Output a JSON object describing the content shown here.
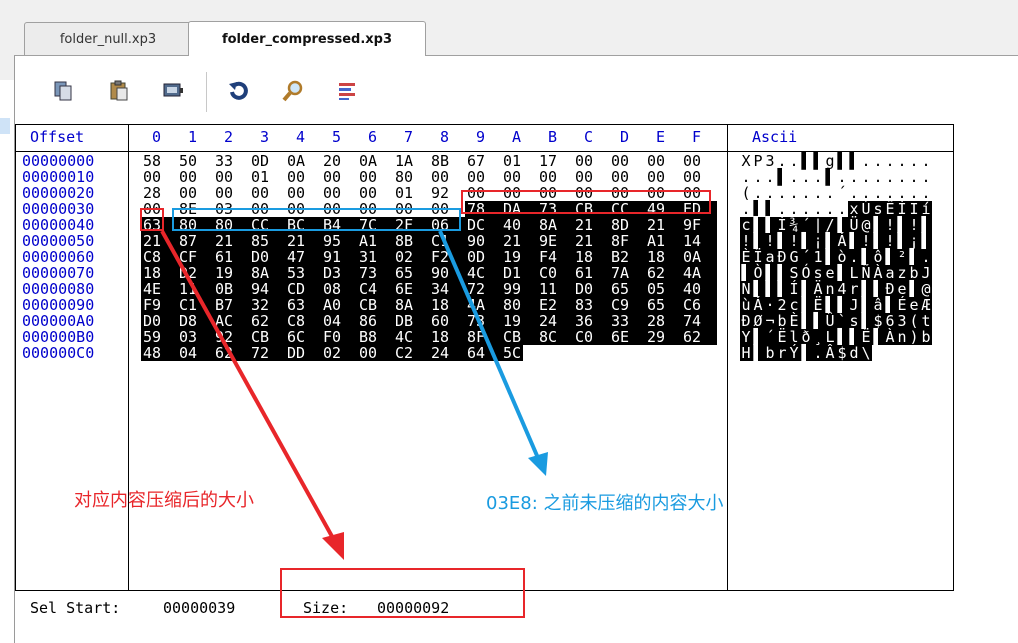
{
  "tabs": [
    {
      "label": "folder_null.xp3",
      "active": false
    },
    {
      "label": "folder_compressed.xp3",
      "active": true
    }
  ],
  "toolbar": {
    "icons": [
      "copy-icon",
      "paste-icon",
      "insert-icon",
      "refresh-icon",
      "find-icon",
      "info-icon"
    ]
  },
  "header": {
    "offset_label": "Offset",
    "columns": [
      "0",
      "1",
      "2",
      "3",
      "4",
      "5",
      "6",
      "7",
      "8",
      "9",
      "A",
      "B",
      "C",
      "D",
      "E",
      "F"
    ],
    "ascii_label": "Ascii"
  },
  "offsets": [
    "00000000",
    "00000010",
    "00000020",
    "00000030",
    "00000040",
    "00000050",
    "00000060",
    "00000070",
    "00000080",
    "00000090",
    "000000A0",
    "000000B0",
    "000000C0"
  ],
  "rows": [
    [
      "58",
      "50",
      "33",
      "0D",
      "0A",
      "20",
      "0A",
      "1A",
      "8B",
      "67",
      "01",
      "17",
      "00",
      "00",
      "00",
      "00"
    ],
    [
      "00",
      "00",
      "00",
      "01",
      "00",
      "00",
      "00",
      "80",
      "00",
      "00",
      "00",
      "00",
      "00",
      "00",
      "00",
      "00"
    ],
    [
      "28",
      "00",
      "00",
      "00",
      "00",
      "00",
      "00",
      "01",
      "92",
      "00",
      "00",
      "00",
      "00",
      "00",
      "00",
      "00"
    ],
    [
      "00",
      "8E",
      "03",
      "00",
      "00",
      "00",
      "00",
      "00",
      "00",
      "78",
      "DA",
      "73",
      "CB",
      "CC",
      "49",
      "ED"
    ],
    [
      "63",
      "80",
      "80",
      "CC",
      "BC",
      "B4",
      "7C",
      "2F",
      "06",
      "DC",
      "40",
      "8A",
      "21",
      "8D",
      "21",
      "9F"
    ],
    [
      "21",
      "87",
      "21",
      "85",
      "21",
      "95",
      "A1",
      "8B",
      "C1",
      "90",
      "21",
      "9E",
      "21",
      "8F",
      "A1",
      "14"
    ],
    [
      "C8",
      "CF",
      "61",
      "D0",
      "47",
      "91",
      "31",
      "02",
      "F2",
      "0D",
      "19",
      "F4",
      "18",
      "B2",
      "18",
      "0A"
    ],
    [
      "18",
      "D2",
      "19",
      "8A",
      "53",
      "D3",
      "73",
      "65",
      "90",
      "4C",
      "D1",
      "C0",
      "61",
      "7A",
      "62",
      "4A"
    ],
    [
      "4E",
      "11",
      "0B",
      "94",
      "CD",
      "08",
      "C4",
      "6E",
      "34",
      "72",
      "99",
      "11",
      "D0",
      "65",
      "05",
      "40"
    ],
    [
      "F9",
      "C1",
      "B7",
      "32",
      "63",
      "A0",
      "CB",
      "8A",
      "18",
      "4A",
      "80",
      "E2",
      "83",
      "C9",
      "65",
      "C6"
    ],
    [
      "D0",
      "D8",
      "AC",
      "62",
      "C8",
      "04",
      "86",
      "DB",
      "60",
      "73",
      "19",
      "24",
      "36",
      "33",
      "28",
      "74"
    ],
    [
      "59",
      "03",
      "92",
      "CB",
      "6C",
      "F0",
      "B8",
      "4C",
      "18",
      "8F",
      "CB",
      "8C",
      "C0",
      "6E",
      "29",
      "62"
    ],
    [
      "48",
      "04",
      "62",
      "72",
      "DD",
      "02",
      "00",
      "C2",
      "24",
      "64",
      "5C"
    ]
  ],
  "ascii": [
    [
      "X",
      "P",
      "3",
      ".",
      ".",
      "▌",
      "▌",
      "g",
      "▌",
      "▌",
      ".",
      ".",
      ".",
      ".",
      ".",
      "."
    ],
    [
      ".",
      ".",
      ".",
      "▌",
      ".",
      ".",
      ".",
      "▌",
      ".",
      ".",
      ".",
      ".",
      ".",
      ".",
      ".",
      "."
    ],
    [
      "(",
      ".",
      ".",
      ".",
      ".",
      ".",
      ".",
      ".",
      "´",
      ".",
      ".",
      ".",
      ".",
      ".",
      ".",
      "."
    ],
    [
      ".",
      "▌",
      "▌",
      ".",
      ".",
      ".",
      ".",
      ".",
      ".",
      "x",
      "Ú",
      "s",
      "Ë",
      "Ì",
      "I",
      "í"
    ],
    [
      "c",
      "▌",
      "▌",
      "Ì",
      "¾",
      "´",
      "|",
      "/",
      "▌",
      "Ü",
      "@",
      "▌",
      "!",
      "▌",
      "!",
      "▌"
    ],
    [
      "!",
      "▌",
      "!",
      "▌",
      "!",
      "▌",
      "¡",
      "▌",
      "Á",
      "▌",
      "!",
      "▌",
      "!",
      "▌",
      "¡",
      "▌"
    ],
    [
      "È",
      "Ï",
      "a",
      "Ð",
      "G",
      "´",
      "1",
      "▌",
      "ò",
      ".",
      "▌",
      "ô",
      "▌",
      "²",
      "▌",
      "."
    ],
    [
      "▌",
      "Ò",
      "▌",
      "▌",
      "S",
      "Ó",
      "s",
      "e",
      "▌",
      "L",
      "Ñ",
      "À",
      "a",
      "z",
      "b",
      "J"
    ],
    [
      "N",
      "▌",
      "▌",
      "▌",
      "Í",
      "▌",
      "Ä",
      "n",
      "4",
      "r",
      "▌",
      "▌",
      "Ð",
      "e",
      "▌",
      "@"
    ],
    [
      "ù",
      "Á",
      "·",
      "2",
      "c",
      "▌",
      "Ë",
      "▌",
      "▌",
      "J",
      "▌",
      "â",
      "▌",
      "É",
      "e",
      "Æ"
    ],
    [
      "Ð",
      "Ø",
      "¬",
      "b",
      "È",
      "▌",
      "▌",
      "Û",
      "`",
      "s",
      "▌",
      "$",
      "6",
      "3",
      "(",
      "t"
    ],
    [
      "Y",
      "▌",
      "´",
      "Ë",
      "l",
      "ð",
      "¸",
      "L",
      "▌",
      "▌",
      "Ë",
      "▌",
      "À",
      "n",
      ")",
      "b"
    ],
    [
      "H",
      "▌",
      "b",
      "r",
      "Ý",
      "▌",
      ".",
      "Â",
      "$",
      "d",
      "\\"
    ]
  ],
  "status": {
    "sel_start_label": "Sel Start:",
    "sel_start_value": "00000039",
    "size_label": "Size:",
    "size_value": "00000092"
  },
  "annotations": {
    "red_label": "对应内容压缩后的大小",
    "blue_label": "03E8: 之前未压缩的内容大小",
    "red_color": "#e8262a",
    "blue_color": "#1a9be0"
  }
}
